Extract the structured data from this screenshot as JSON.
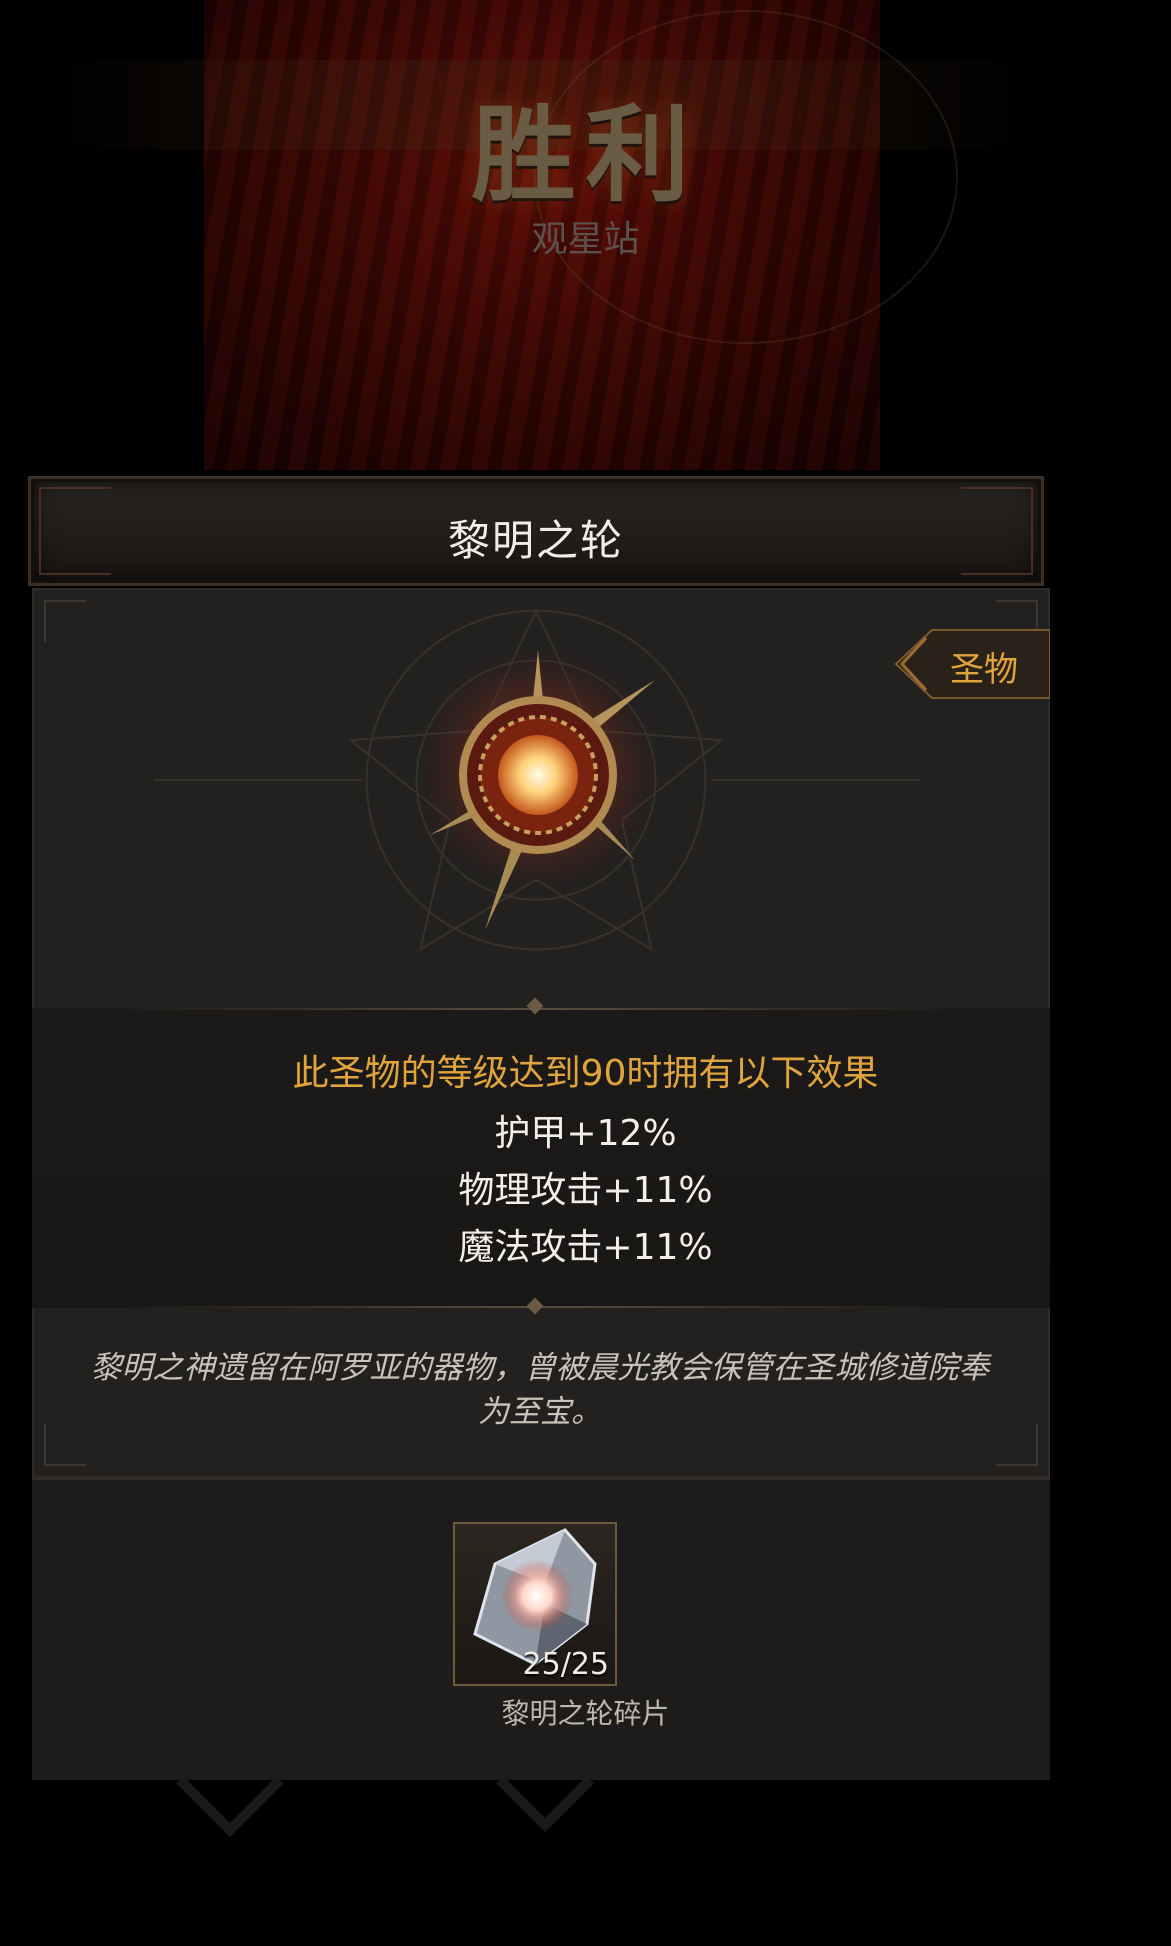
{
  "background": {
    "victory_title": "胜利",
    "victory_subtitle": "观星站"
  },
  "dialog": {
    "title": "黎明之轮",
    "type_tag": "圣物",
    "effect_heading": "此圣物的等级达到90时拥有以下效果",
    "effects": [
      "护甲+12%",
      "物理攻击+11%",
      "魔法攻击+11%"
    ],
    "lore": "黎明之神遗留在阿罗亚的器物，曾被晨光教会保管在圣城修道院奉为至宝。",
    "reward": {
      "name": "黎明之轮碎片",
      "count": "25/25"
    }
  },
  "colors": {
    "accent_gold": "#e0a43c",
    "panel_bg": "#232120",
    "text_light": "#f3efe8"
  },
  "icons": [
    "dawn-wheel-relic-icon",
    "shard-icon",
    "type-tag-arrow-icon"
  ]
}
